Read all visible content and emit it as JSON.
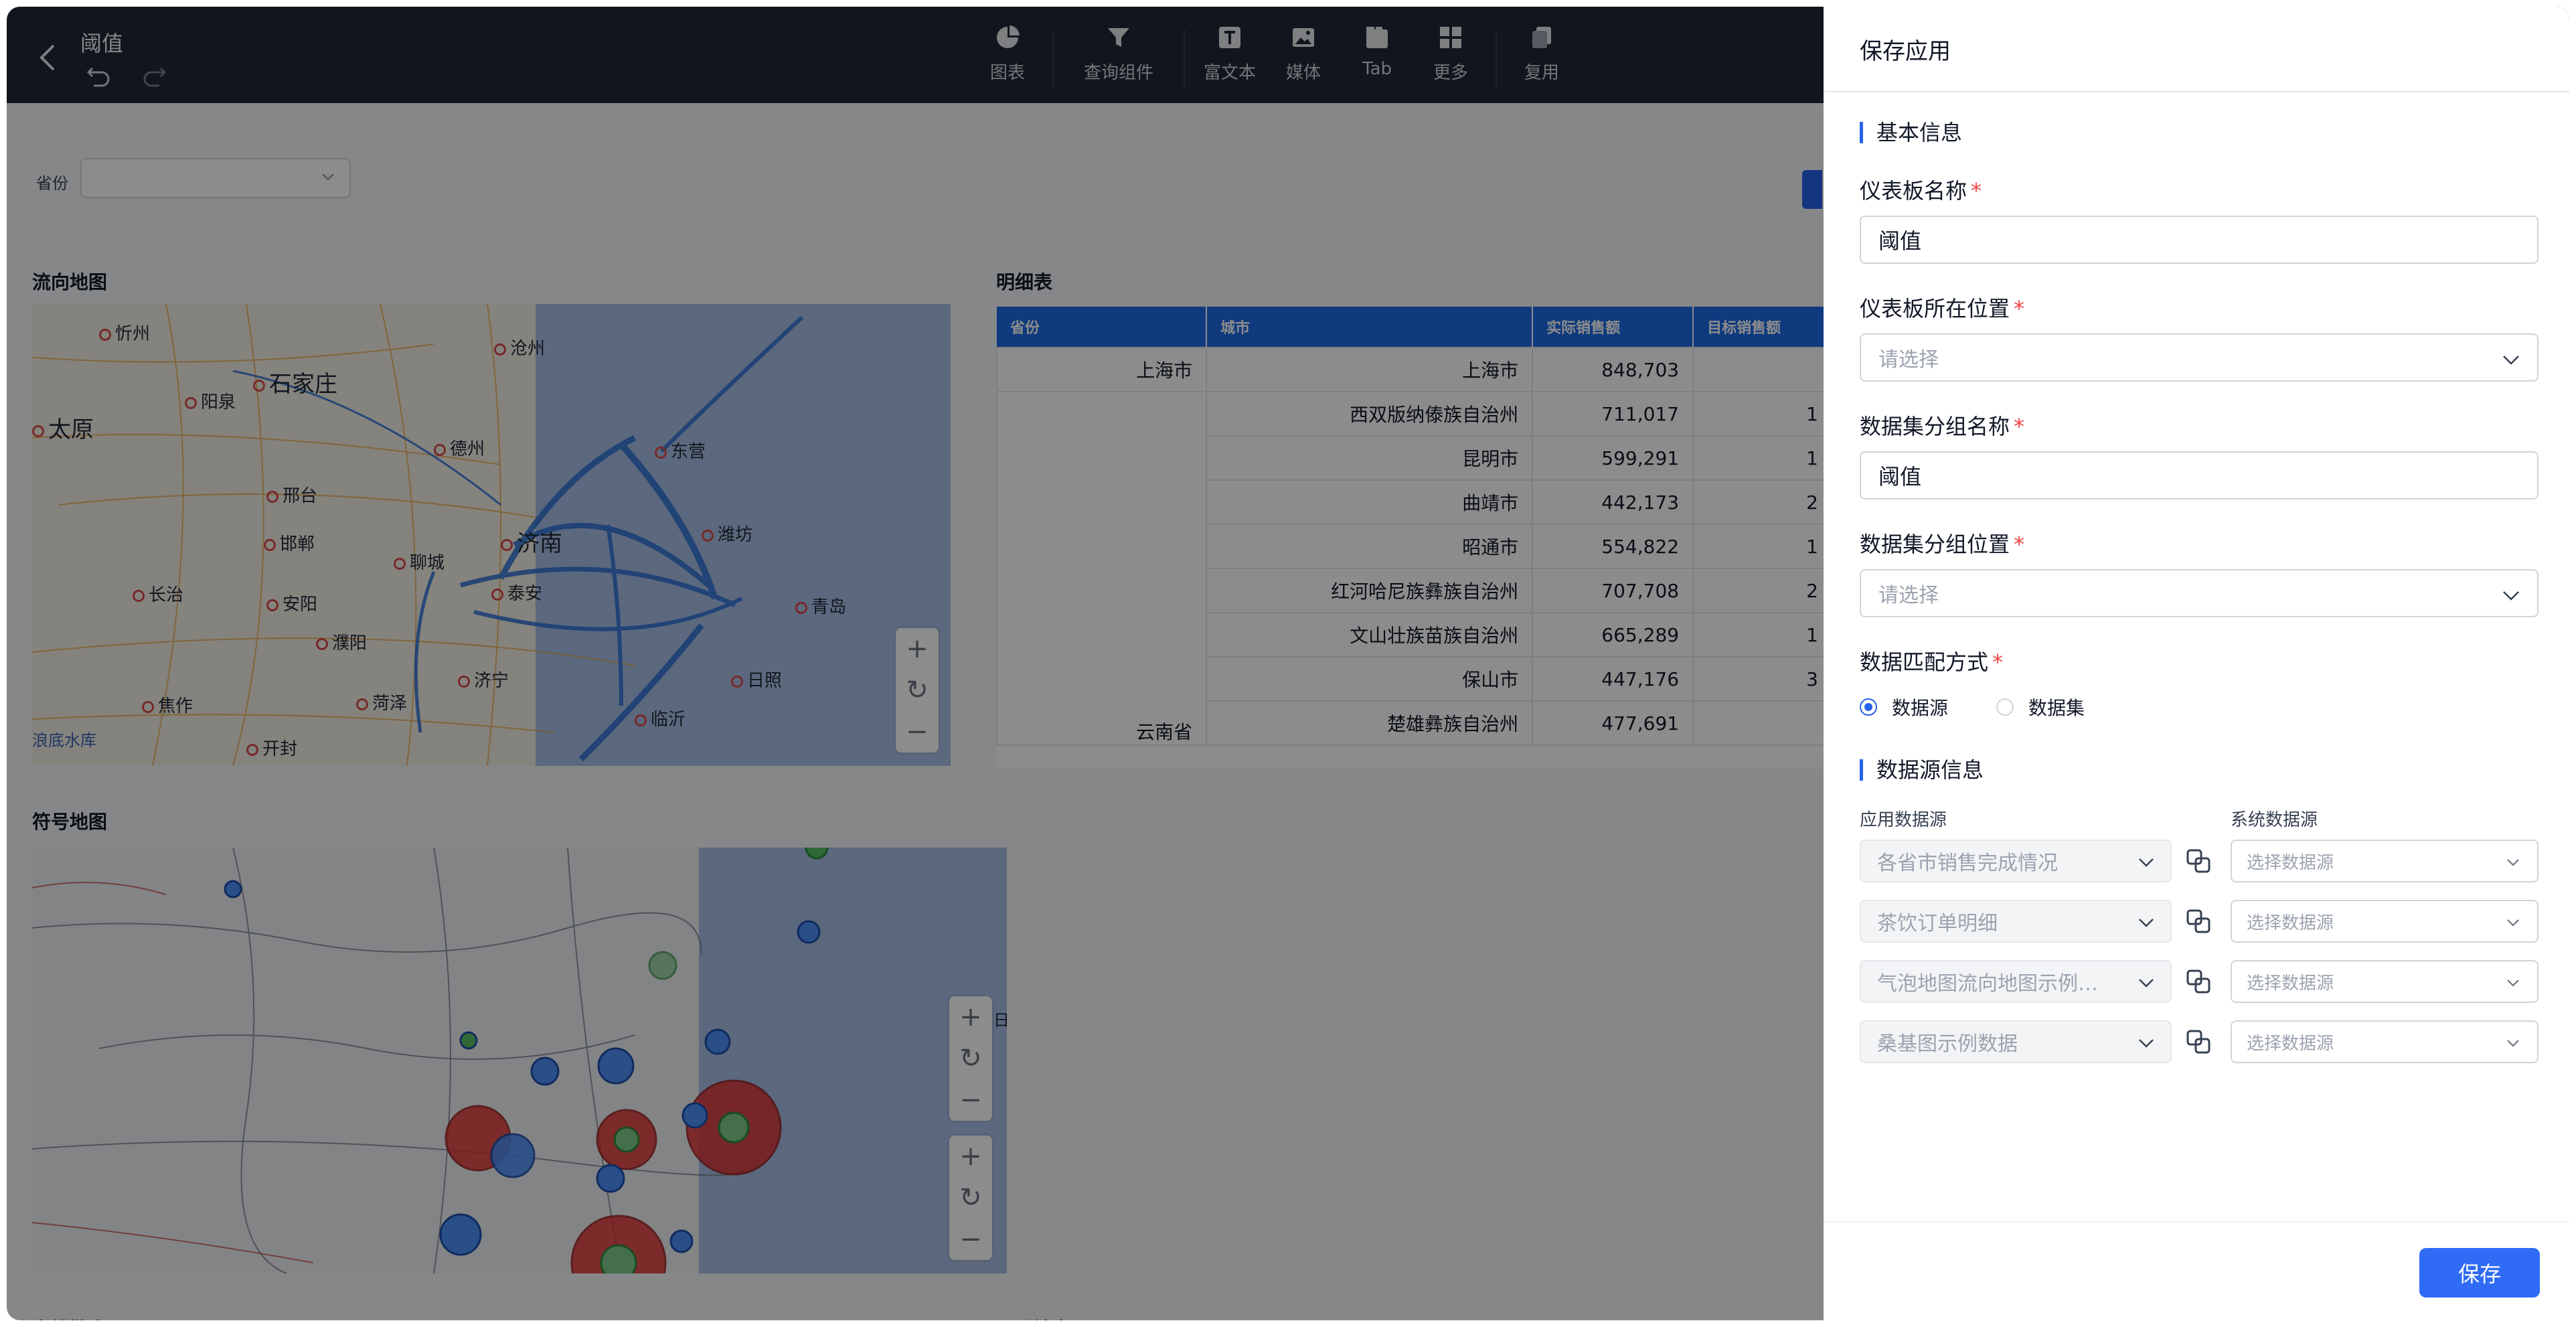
{
  "header": {
    "title": "阈值",
    "toolbar": [
      {
        "label": "图表",
        "icon": "pie-chart-icon"
      },
      {
        "label": "查询组件",
        "icon": "filter-icon"
      },
      {
        "label": "富文本",
        "icon": "text-icon"
      },
      {
        "label": "媒体",
        "icon": "image-icon"
      },
      {
        "label": "Tab",
        "icon": "tab-icon"
      },
      {
        "label": "更多",
        "icon": "grid-icon"
      },
      {
        "label": "复用",
        "icon": "copy-icon"
      }
    ]
  },
  "canvas": {
    "filter": {
      "label": "省份",
      "value": ""
    },
    "flow_map": {
      "title": "流向地图",
      "cities": [
        "忻州",
        "石家庄",
        "沧州",
        "阳泉",
        "太原",
        "德州",
        "东营",
        "邢台",
        "潍坊",
        "邯郸",
        "聊城",
        "济南",
        "长治",
        "安阳",
        "泰安",
        "青岛",
        "濮阳",
        "菏泽",
        "济宁",
        "日照",
        "焦作",
        "临沂",
        "开封",
        "浪底水库"
      ]
    },
    "detail_table": {
      "title": "明细表",
      "columns": [
        "省份",
        "城市",
        "实际销售额",
        "目标销售额"
      ],
      "rows": [
        {
          "province": "上海市",
          "city": "上海市",
          "actual": "848,703",
          "target": ""
        },
        {
          "province": "",
          "city": "西双版纳傣族自治州",
          "actual": "711,017",
          "target": "1"
        },
        {
          "province": "",
          "city": "昆明市",
          "actual": "599,291",
          "target": "1"
        },
        {
          "province": "",
          "city": "曲靖市",
          "actual": "442,173",
          "target": "2"
        },
        {
          "province": "",
          "city": "昭通市",
          "actual": "554,822",
          "target": "1"
        },
        {
          "province": "",
          "city": "红河哈尼族彝族自治州",
          "actual": "707,708",
          "target": "2"
        },
        {
          "province": "",
          "city": "文山壮族苗族自治州",
          "actual": "665,289",
          "target": "1"
        },
        {
          "province": "",
          "city": "保山市",
          "actual": "447,176",
          "target": "3"
        },
        {
          "province": "云南省",
          "city": "楚雄彝族自治州",
          "actual": "477,691",
          "target": ""
        }
      ]
    },
    "symbol_map": {
      "title": "符号地图",
      "label_right": "日"
    },
    "bottom_titles": [
      "多维散点图",
      "圆形填充图"
    ]
  },
  "drawer": {
    "title": "保存应用",
    "section_basic": "基本信息",
    "dashboard_name_label": "仪表板名称",
    "dashboard_name_value": "阈值",
    "dashboard_location_label": "仪表板所在位置",
    "dashboard_location_placeholder": "请选择",
    "dataset_group_name_label": "数据集分组名称",
    "dataset_group_name_value": "阈值",
    "dataset_group_location_label": "数据集分组位置",
    "dataset_group_location_placeholder": "请选择",
    "match_mode_label": "数据匹配方式",
    "match_options": [
      "数据源",
      "数据集"
    ],
    "match_selected": "数据源",
    "section_datasource": "数据源信息",
    "app_ds_header": "应用数据源",
    "sys_ds_header": "系统数据源",
    "datasources": [
      {
        "app": "各省市销售完成情况",
        "sys_placeholder": "选择数据源"
      },
      {
        "app": "茶饮订单明细",
        "sys_placeholder": "选择数据源"
      },
      {
        "app": "气泡地图流向地图示例…",
        "sys_placeholder": "选择数据源"
      },
      {
        "app": "桑基图示例数据",
        "sys_placeholder": "选择数据源"
      }
    ],
    "save_label": "保存"
  },
  "colors": {
    "primary": "#2f6bf5",
    "topbar": "#1f2937",
    "table_header": "#1d6ae5",
    "required": "#ef4444"
  }
}
